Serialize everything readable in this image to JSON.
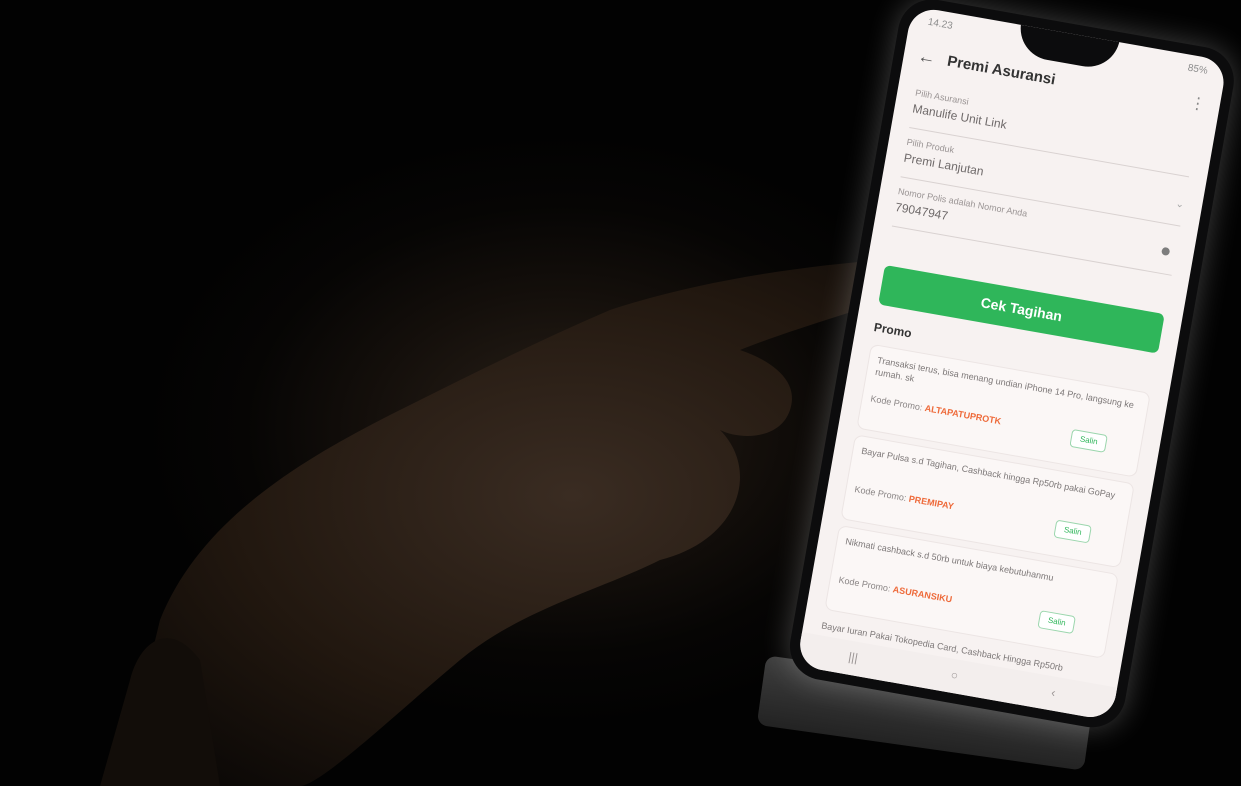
{
  "status_bar": {
    "time": "14.23",
    "battery": "85%"
  },
  "header": {
    "title": "Premi Asuransi"
  },
  "fields": [
    {
      "label": "Pilih Asuransi",
      "value": "Manulife Unit Link"
    },
    {
      "label": "Pilih Produk",
      "value": "Premi Lanjutan"
    },
    {
      "label": "Nomor Polis adalah Nomor Anda",
      "value": "79047947"
    }
  ],
  "cek_button": "Cek Tagihan",
  "promo": {
    "title": "Promo",
    "cards": [
      {
        "desc": "Transaksi terus, bisa menang undian iPhone 14 Pro, langsung ke rumah. sk",
        "code_label": "Kode Promo:",
        "code": "ALTAPATUPROTK",
        "copy": "Salin"
      },
      {
        "desc": "Bayar Pulsa s.d Tagihan, Cashback hingga Rp50rb pakai GoPay",
        "code_label": "Kode Promo:",
        "code": "PREMIPAY",
        "copy": "Salin"
      },
      {
        "desc": "Nikmati cashback s.d 50rb untuk biaya kebutuhanmu",
        "code_label": "Kode Promo:",
        "code": "ASURANSIKU",
        "copy": "Salin"
      }
    ],
    "footer": "Bayar Iuran Pakai Tokopedia Card, Cashback Hingga Rp50rb"
  },
  "colors": {
    "accent": "#2fb65a",
    "promo_code": "#ee6a3a",
    "screen_bg": "#f7f2f1"
  }
}
